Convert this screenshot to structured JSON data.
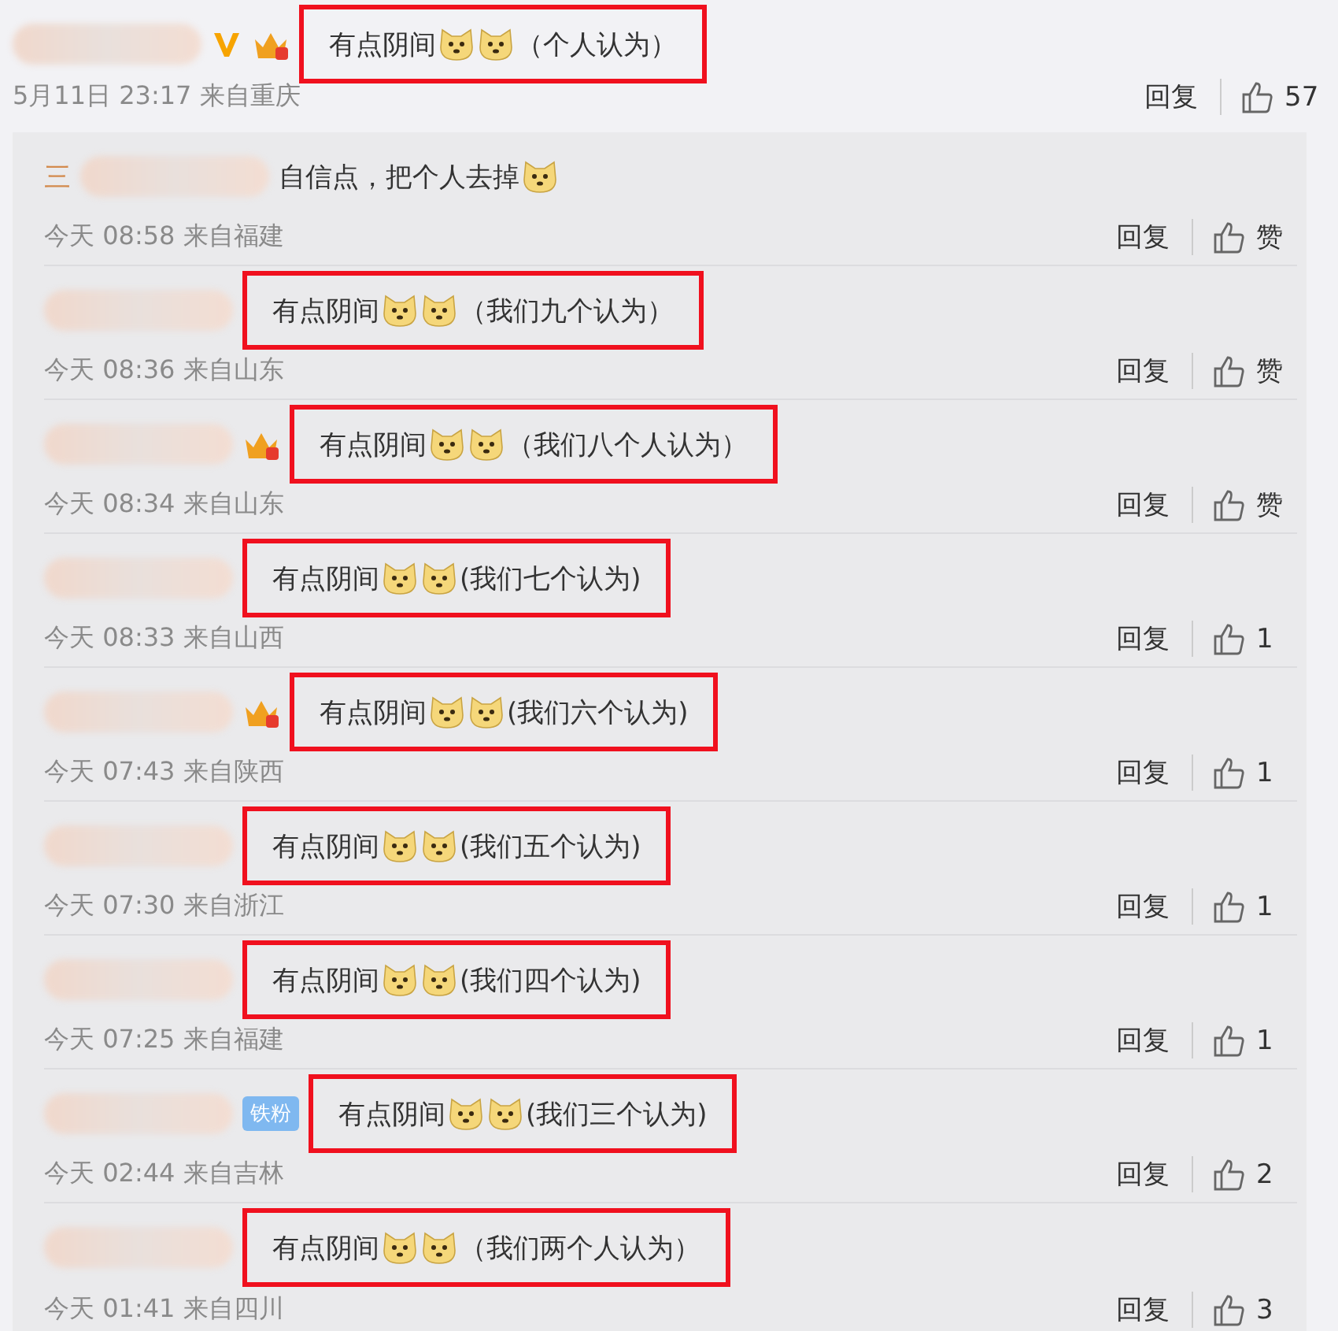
{
  "top_comment": {
    "badges": [
      {
        "kind": "verified"
      },
      {
        "kind": "crown"
      }
    ],
    "content": [
      {
        "kind": "text",
        "text": "有点阴间"
      },
      {
        "kind": "emoji"
      },
      {
        "kind": "emoji"
      },
      {
        "kind": "text",
        "text": "（个人认为）"
      }
    ],
    "annotated": true,
    "time": "5月11日 23:17 来自重庆",
    "reply": "回复",
    "likes": "57"
  },
  "replies": [
    {
      "name_fragment": "三",
      "content": [
        {
          "kind": "text",
          "text": "自信点，把个人去掉"
        },
        {
          "kind": "emoji"
        }
      ],
      "annotated": false,
      "time": "今天 08:58 来自福建",
      "reply": "回复",
      "likes": "赞"
    },
    {
      "content": [
        {
          "kind": "text",
          "text": "有点阴间"
        },
        {
          "kind": "emoji"
        },
        {
          "kind": "emoji"
        },
        {
          "kind": "text",
          "text": "（我们九个认为）"
        }
      ],
      "annotated": true,
      "time": "今天 08:36 来自山东",
      "reply": "回复",
      "likes": "赞"
    },
    {
      "badges": [
        {
          "kind": "crown"
        }
      ],
      "content": [
        {
          "kind": "text",
          "text": "有点阴间"
        },
        {
          "kind": "emoji"
        },
        {
          "kind": "emoji"
        },
        {
          "kind": "text",
          "text": "（我们八个人认为）"
        }
      ],
      "annotated": true,
      "time": "今天 08:34 来自山东",
      "reply": "回复",
      "likes": "赞"
    },
    {
      "content": [
        {
          "kind": "text",
          "text": "有点阴间"
        },
        {
          "kind": "emoji"
        },
        {
          "kind": "emoji"
        },
        {
          "kind": "text",
          "text": "(我们七个认为)"
        }
      ],
      "annotated": true,
      "time": "今天 08:33 来自山西",
      "reply": "回复",
      "likes": "1"
    },
    {
      "badges": [
        {
          "kind": "crown"
        }
      ],
      "content": [
        {
          "kind": "text",
          "text": "有点阴间"
        },
        {
          "kind": "emoji"
        },
        {
          "kind": "emoji"
        },
        {
          "kind": "text",
          "text": "(我们六个认为)"
        }
      ],
      "annotated": true,
      "time": "今天 07:43 来自陕西",
      "reply": "回复",
      "likes": "1"
    },
    {
      "content": [
        {
          "kind": "text",
          "text": "有点阴间"
        },
        {
          "kind": "emoji"
        },
        {
          "kind": "emoji"
        },
        {
          "kind": "text",
          "text": "(我们五个认为)"
        }
      ],
      "annotated": true,
      "time": "今天 07:30 来自浙江",
      "reply": "回复",
      "likes": "1"
    },
    {
      "content": [
        {
          "kind": "text",
          "text": "有点阴间"
        },
        {
          "kind": "emoji"
        },
        {
          "kind": "emoji"
        },
        {
          "kind": "text",
          "text": "(我们四个认为)"
        }
      ],
      "annotated": true,
      "time": "今天 07:25 来自福建",
      "reply": "回复",
      "likes": "1"
    },
    {
      "badges": [
        {
          "kind": "tag",
          "text": "铁粉"
        }
      ],
      "content": [
        {
          "kind": "text",
          "text": "有点阴间"
        },
        {
          "kind": "emoji"
        },
        {
          "kind": "emoji"
        },
        {
          "kind": "text",
          "text": "(我们三个认为)"
        }
      ],
      "annotated": true,
      "time": "今天 02:44 来自吉林",
      "reply": "回复",
      "likes": "2"
    },
    {
      "content": [
        {
          "kind": "text",
          "text": "有点阴间"
        },
        {
          "kind": "emoji"
        },
        {
          "kind": "emoji"
        },
        {
          "kind": "text",
          "text": "（我们两个人认为）"
        }
      ],
      "annotated": true,
      "time": "今天 01:41 来自四川",
      "reply": "回复",
      "likes": "3"
    }
  ]
}
